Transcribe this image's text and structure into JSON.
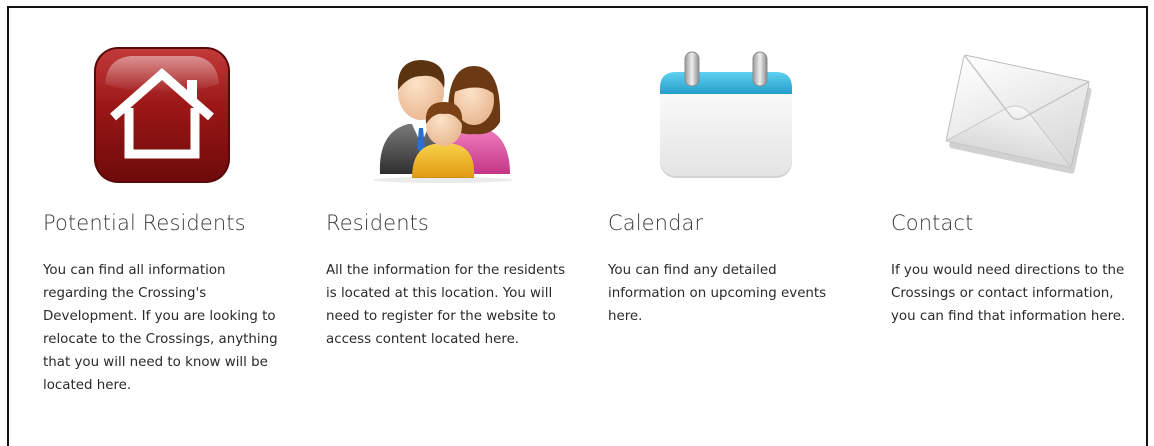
{
  "features": [
    {
      "icon": "home-icon",
      "title": "Potential Residents",
      "description": "You can find all information regarding the Crossing's Development. If you are looking to relocate to the Crossings, anything that you will need to know will be located here."
    },
    {
      "icon": "family-icon",
      "title": "Residents",
      "description": "All the information for the residents is located at this location. You will need to register for the website to access content located here."
    },
    {
      "icon": "calendar-icon",
      "title": "Calendar",
      "description": "You can find any detailed information on upcoming events here."
    },
    {
      "icon": "envelope-icon",
      "title": "Contact",
      "description": "If you would need directions to the Crossings or contact information, you can find that information here."
    }
  ],
  "colors": {
    "home_red": "#8e1212",
    "calendar_blue": "#3bb6de",
    "family_pink": "#e65aa8",
    "family_yellow": "#f2b51c",
    "heading_text": "#3a3a3a",
    "body_text": "#2a2a2a"
  }
}
